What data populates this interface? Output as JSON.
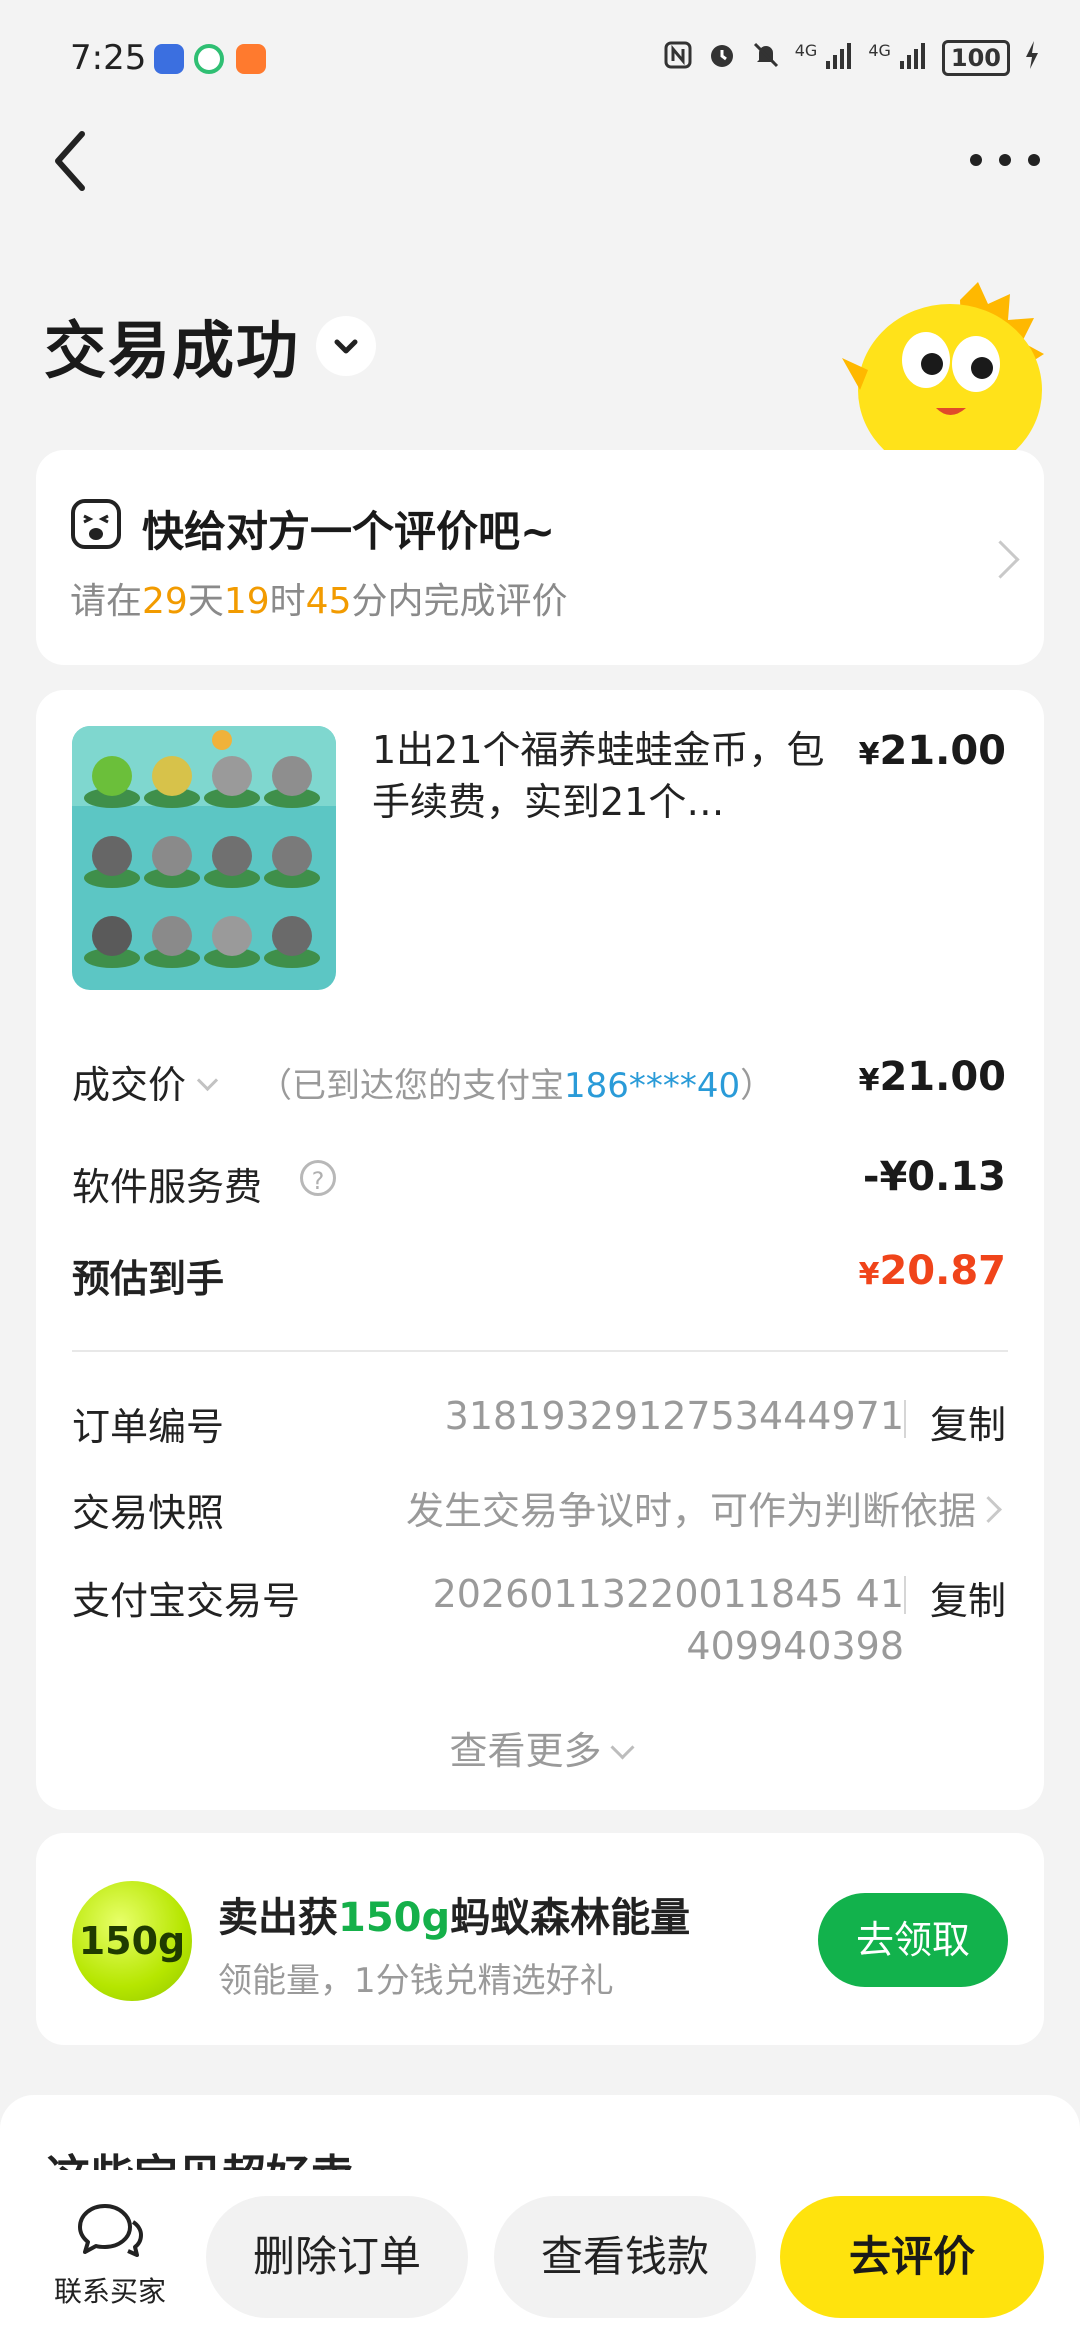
{
  "status_bar": {
    "time": "7:25",
    "signal1": "4G",
    "signal2": "4G",
    "battery": "100"
  },
  "header": {
    "title": "交易成功"
  },
  "review_prompt": {
    "title": "快给对方一个评价吧~",
    "sub_prefix": "请在",
    "days": "29",
    "days_unit": "天",
    "hours": "19",
    "hours_unit": "时",
    "minutes": "45",
    "sub_suffix": "分内完成评价"
  },
  "order": {
    "item_title": "1出21个福养蛙蛙金币，包手续费，实到21个…",
    "item_price": "21.00",
    "currency": "¥",
    "deal_price_label": "成交价",
    "deal_note_prefix": "（已到达您的支付宝",
    "alipay_account": "186****40",
    "deal_note_suffix": "）",
    "deal_price": "21.00",
    "service_fee_label": "软件服务费",
    "service_fee": "-¥0.13",
    "estimated_label": "预估到手",
    "estimated": "20.87",
    "order_no_label": "订单编号",
    "order_no": "3181932912753444971",
    "copy_label": "复制",
    "snapshot_label": "交易快照",
    "snapshot_value": "发生交易争议时，可作为判断依据",
    "alipay_no_label": "支付宝交易号",
    "alipay_no_line1": "20260113220011845 41",
    "alipay_no_line2": "409940398",
    "see_more": "查看更多"
  },
  "energy": {
    "badge": "150g",
    "title_prefix": "卖出获",
    "amount": "150g",
    "title_suffix": "蚂蚁森林能量",
    "subtitle": "领能量，1分钱兑精选好礼",
    "button": "去领取"
  },
  "peek": {
    "text": "这些宝贝超好卖"
  },
  "bottom_bar": {
    "contact": "联系买家",
    "delete": "删除订单",
    "view_money": "查看钱款",
    "review": "去评价"
  },
  "colors": {
    "accent_yellow": "#ffe30d",
    "green": "#12b24c",
    "orange": "#f29b00",
    "price_red": "#f0441a",
    "link_blue": "#2a9bd8"
  }
}
